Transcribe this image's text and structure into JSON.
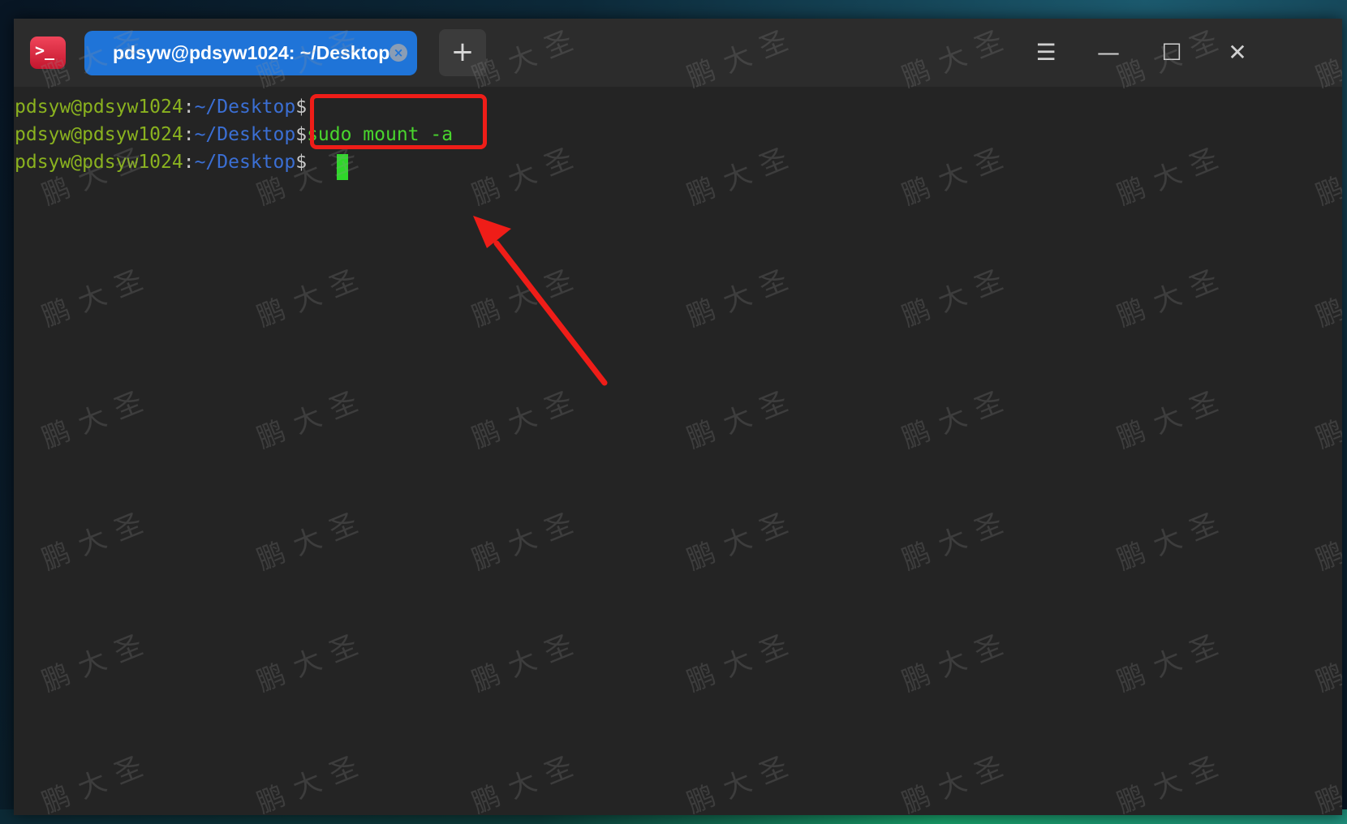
{
  "app": {
    "icon_glyph": ">_"
  },
  "tabs": [
    {
      "label": "pdsyw@pdsyw1024: ~/Desktop",
      "close_glyph": "×",
      "active": true
    }
  ],
  "titlebar": {
    "new_tab_glyph": "+",
    "menu_glyph": "☰",
    "minimize_glyph": "—",
    "maximize_glyph": "☐",
    "close_glyph": "✕"
  },
  "terminal": {
    "lines": [
      {
        "user": "pdsyw@pdsyw1024",
        "colon": ":",
        "path": "~/Desktop",
        "dollar": "$",
        "command": ""
      },
      {
        "user": "pdsyw@pdsyw1024",
        "colon": ":",
        "path": "~/Desktop",
        "dollar": "$",
        "command": "sudo mount -a"
      },
      {
        "user": "pdsyw@pdsyw1024",
        "colon": ":",
        "path": "~/Desktop",
        "dollar": "$",
        "command": ""
      }
    ]
  },
  "watermark": {
    "text": "鹏大圣"
  },
  "colors": {
    "accent_tab": "#1f74d8",
    "prompt_user": "#8ab21f",
    "prompt_path": "#3b6fd4",
    "command": "#49d62d",
    "annotation": "#ef1d18"
  }
}
